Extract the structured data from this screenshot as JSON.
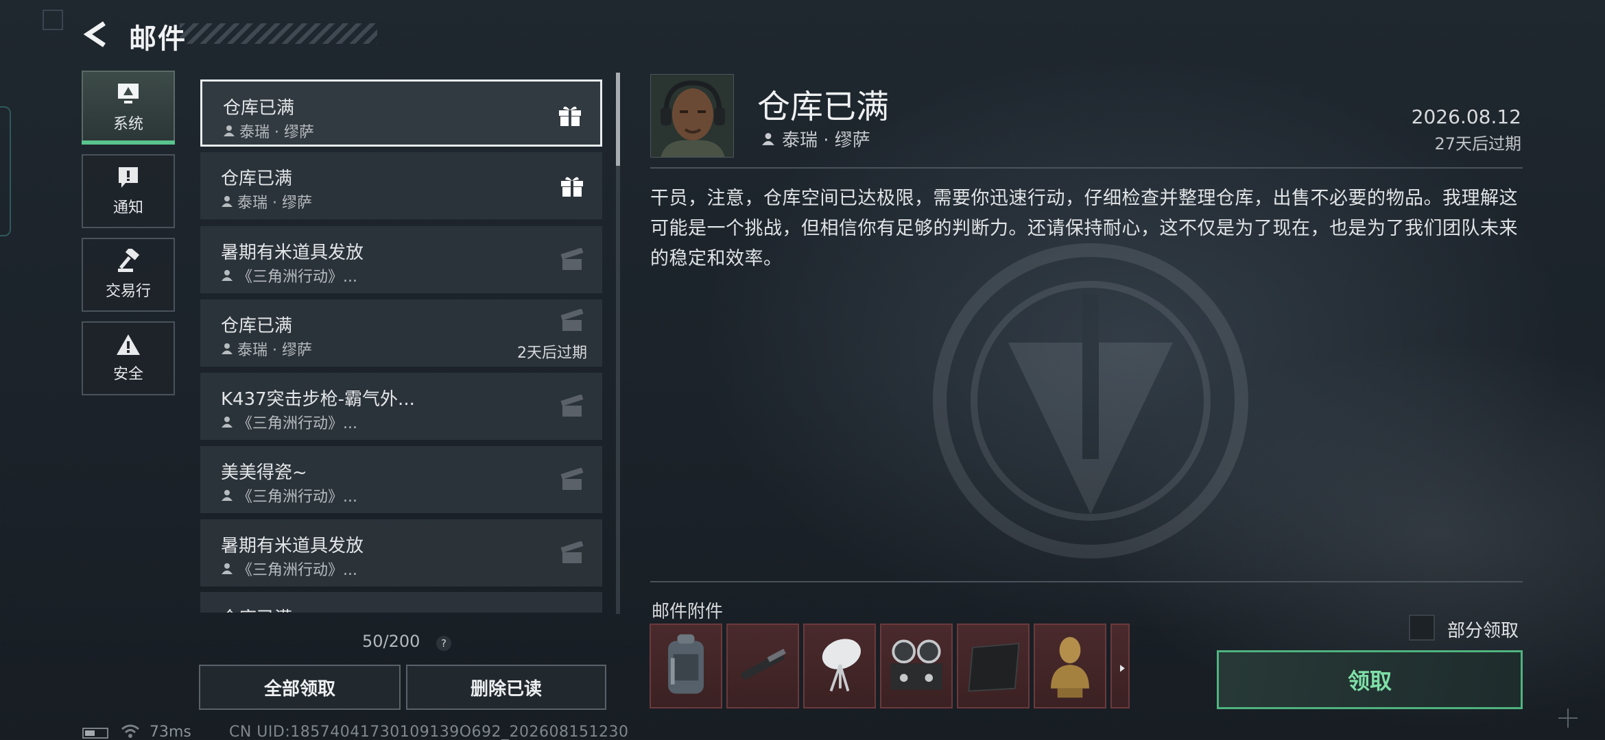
{
  "header": {
    "title": "邮件"
  },
  "categories": [
    {
      "label": "系统",
      "icon": "monitor-icon",
      "active": true
    },
    {
      "label": "通知",
      "icon": "alert-bubble-icon",
      "active": false
    },
    {
      "label": "交易行",
      "icon": "gavel-icon",
      "active": false
    },
    {
      "label": "安全",
      "icon": "warning-triangle-icon",
      "active": false
    }
  ],
  "mails": [
    {
      "title": "仓库已满",
      "sender": "泰瑞 · 缪萨",
      "expiry": ""
    },
    {
      "title": "仓库已满",
      "sender": "泰瑞 · 缪萨",
      "expiry": ""
    },
    {
      "title": "暑期有米道具发放",
      "sender": "《三角洲行动》...",
      "expiry": ""
    },
    {
      "title": "仓库已满",
      "sender": "泰瑞 · 缪萨",
      "expiry": "2天后过期"
    },
    {
      "title": "K437突击步枪-霸气外...",
      "sender": "《三角洲行动》...",
      "expiry": ""
    },
    {
      "title": "美美得瓷~",
      "sender": "《三角洲行动》...",
      "expiry": ""
    },
    {
      "title": "暑期有米道具发放",
      "sender": "《三角洲行动》...",
      "expiry": ""
    },
    {
      "title": "仓库已满",
      "sender": "",
      "expiry": ""
    }
  ],
  "list_footer": {
    "count": "50/200",
    "help": "?",
    "claim_all": "全部领取",
    "delete_read": "删除已读"
  },
  "detail": {
    "title": "仓库已满",
    "sender": "泰瑞 · 缪萨",
    "date": "2026.08.12",
    "expiry": "27天后过期",
    "body": "干员，注意，仓库空间已达极限，需要你迅速行动，仔细检查并整理仓库，出售不必要的物品。我理解这可能是一个挑战，但相信你有足够的判断力。还请保持耐心，这不仅是为了现在，也是为了我们团队未来的稳定和效率。",
    "attachments_label": "邮件附件",
    "attachments": [
      "backpack-icon",
      "knife-icon",
      "satellite-dish-icon",
      "tape-recorder-icon",
      "metal-plate-icon",
      "bust-statue-icon",
      "item-icon"
    ],
    "partial_claim_label": "部分领取",
    "claim_label": "领取"
  },
  "status": {
    "ping": "73ms",
    "uid": "CN UID:18574041730109139O692_202608151230"
  },
  "colors": {
    "accent_green": "#59c48e",
    "claim_text": "#7fe0a8",
    "attachment_bg": "#4a2a2c"
  }
}
